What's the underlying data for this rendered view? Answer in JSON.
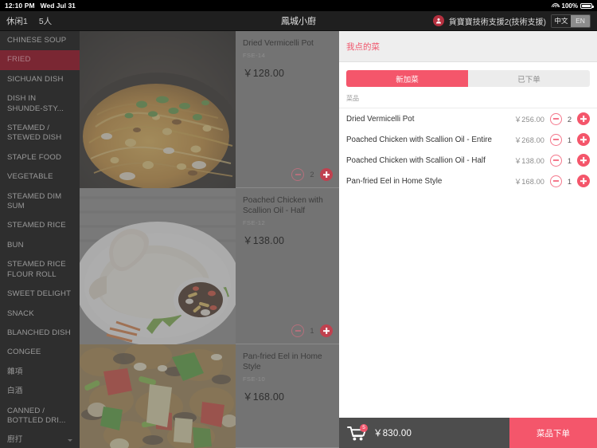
{
  "statusbar": {
    "time": "12:10 PM",
    "date": "Wed Jul 31",
    "battery_pct": "100%",
    "wifi_icon": "wifi-icon",
    "battery_icon": "battery-icon"
  },
  "header": {
    "table_label": "休闲1",
    "guest_count": "5人",
    "restaurant_name": "鳳城小廚",
    "user_name": "貨寶寶技術支援2(技術支援)",
    "user_icon": "person-icon",
    "lang_cn": "中文",
    "lang_en": "EN"
  },
  "sidebar": {
    "categories": [
      {
        "label": "CHINESE SOUP",
        "active": false
      },
      {
        "label": "FRIED",
        "active": true
      },
      {
        "label": "SICHUAN DISH",
        "active": false
      },
      {
        "label": "DISH IN SHUNDE-STY...",
        "active": false
      },
      {
        "label": "STEAMED / STEWED DISH",
        "active": false
      },
      {
        "label": "STAPLE FOOD",
        "active": false
      },
      {
        "label": "VEGETABLE",
        "active": false
      },
      {
        "label": "STEAMED DIM SUM",
        "active": false
      },
      {
        "label": "STEAMED RICE",
        "active": false
      },
      {
        "label": "BUN",
        "active": false
      },
      {
        "label": "STEAMED RICE FLOUR ROLL",
        "active": false
      },
      {
        "label": "SWEET DELIGHT",
        "active": false
      },
      {
        "label": "SNACK",
        "active": false
      },
      {
        "label": "BLANCHED DISH",
        "active": false
      },
      {
        "label": "CONGEE",
        "active": false
      },
      {
        "label": "雜項",
        "active": false
      },
      {
        "label": "白酒",
        "active": false
      },
      {
        "label": "CANNED / BOTTLED DRI...",
        "active": false
      },
      {
        "label": "廚打",
        "active": false,
        "chevron": true
      }
    ]
  },
  "menu": {
    "dishes": [
      {
        "name": "Dried Vermicelli Pot",
        "code": "FSE-14",
        "price": "￥128.00",
        "qty": "2",
        "photo": "dried-vermicelli-pot-photo"
      },
      {
        "name": "Poached Chicken with Scallion Oil - Half",
        "code": "FSE-12",
        "price": "￥138.00",
        "qty": "1",
        "photo": "poached-chicken-photo"
      },
      {
        "name": "Pan-fried Eel in Home Style",
        "code": "FSE-10",
        "price": "￥168.00",
        "qty": "",
        "photo": "pan-fried-eel-photo"
      }
    ],
    "minus_icon": "minus-icon",
    "plus_icon": "plus-icon"
  },
  "order_panel": {
    "title": "我点的菜",
    "tab_new": "新加菜",
    "tab_placed": "已下单",
    "column_header": "菜品",
    "items": [
      {
        "name": "Dried Vermicelli Pot",
        "price": "￥256.00",
        "qty": "2"
      },
      {
        "name": "Poached Chicken with Scallion Oil - Entire",
        "price": "￥268.00",
        "qty": "1"
      },
      {
        "name": "Poached Chicken with Scallion Oil - Half",
        "price": "￥138.00",
        "qty": "1"
      },
      {
        "name": "Pan-fried Eel in Home Style",
        "price": "￥168.00",
        "qty": "1"
      }
    ]
  },
  "bottom_bar": {
    "cart_icon": "shopping-cart-icon",
    "cart_badge": "5",
    "total": "￥830.00",
    "submit_label": "菜品下单"
  },
  "colors": {
    "accent_pink": "#f4566b",
    "accent_dark_red": "#c0414f",
    "sidebar_bg": "#2e2e2e",
    "sidebar_active": "#7a2733",
    "dish_col_bg": "#737373",
    "bottom_bar_bg": "#4d4d4d"
  }
}
